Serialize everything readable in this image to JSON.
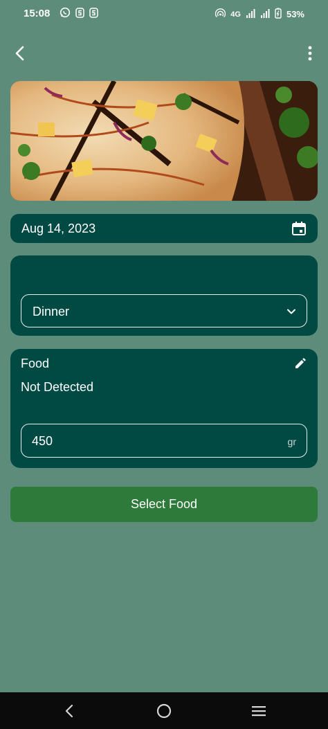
{
  "status_bar": {
    "time": "15:08",
    "network": "4G",
    "battery": "53%",
    "left_icons": [
      "whatsapp-icon",
      "app-s-icon",
      "app-s-icon"
    ],
    "right_icons": [
      "hotspot-icon",
      "signal-icon",
      "signal-icon",
      "battery-charging-icon"
    ]
  },
  "app_bar": {
    "back_icon": "chevron-left-icon",
    "menu_icon": "more-vertical-icon"
  },
  "hero": {
    "image_subject": "pizza"
  },
  "date": {
    "value": "Aug 14, 2023",
    "icon": "calendar-icon"
  },
  "meal": {
    "selected": "Dinner",
    "icon": "chevron-down-icon"
  },
  "food": {
    "title": "Food",
    "status": "Not Detected",
    "edit_icon": "pencil-icon",
    "weight_value": "450",
    "weight_unit": "gr"
  },
  "actions": {
    "select_food_label": "Select Food"
  },
  "nav_bar": {
    "back_icon": "nav-back-icon",
    "home_icon": "nav-home-icon",
    "recents_icon": "nav-menu-icon"
  },
  "colors": {
    "background": "#5e8c7b",
    "card": "#014a44",
    "button": "#2e7a3a",
    "nav": "#0b0b0b"
  }
}
